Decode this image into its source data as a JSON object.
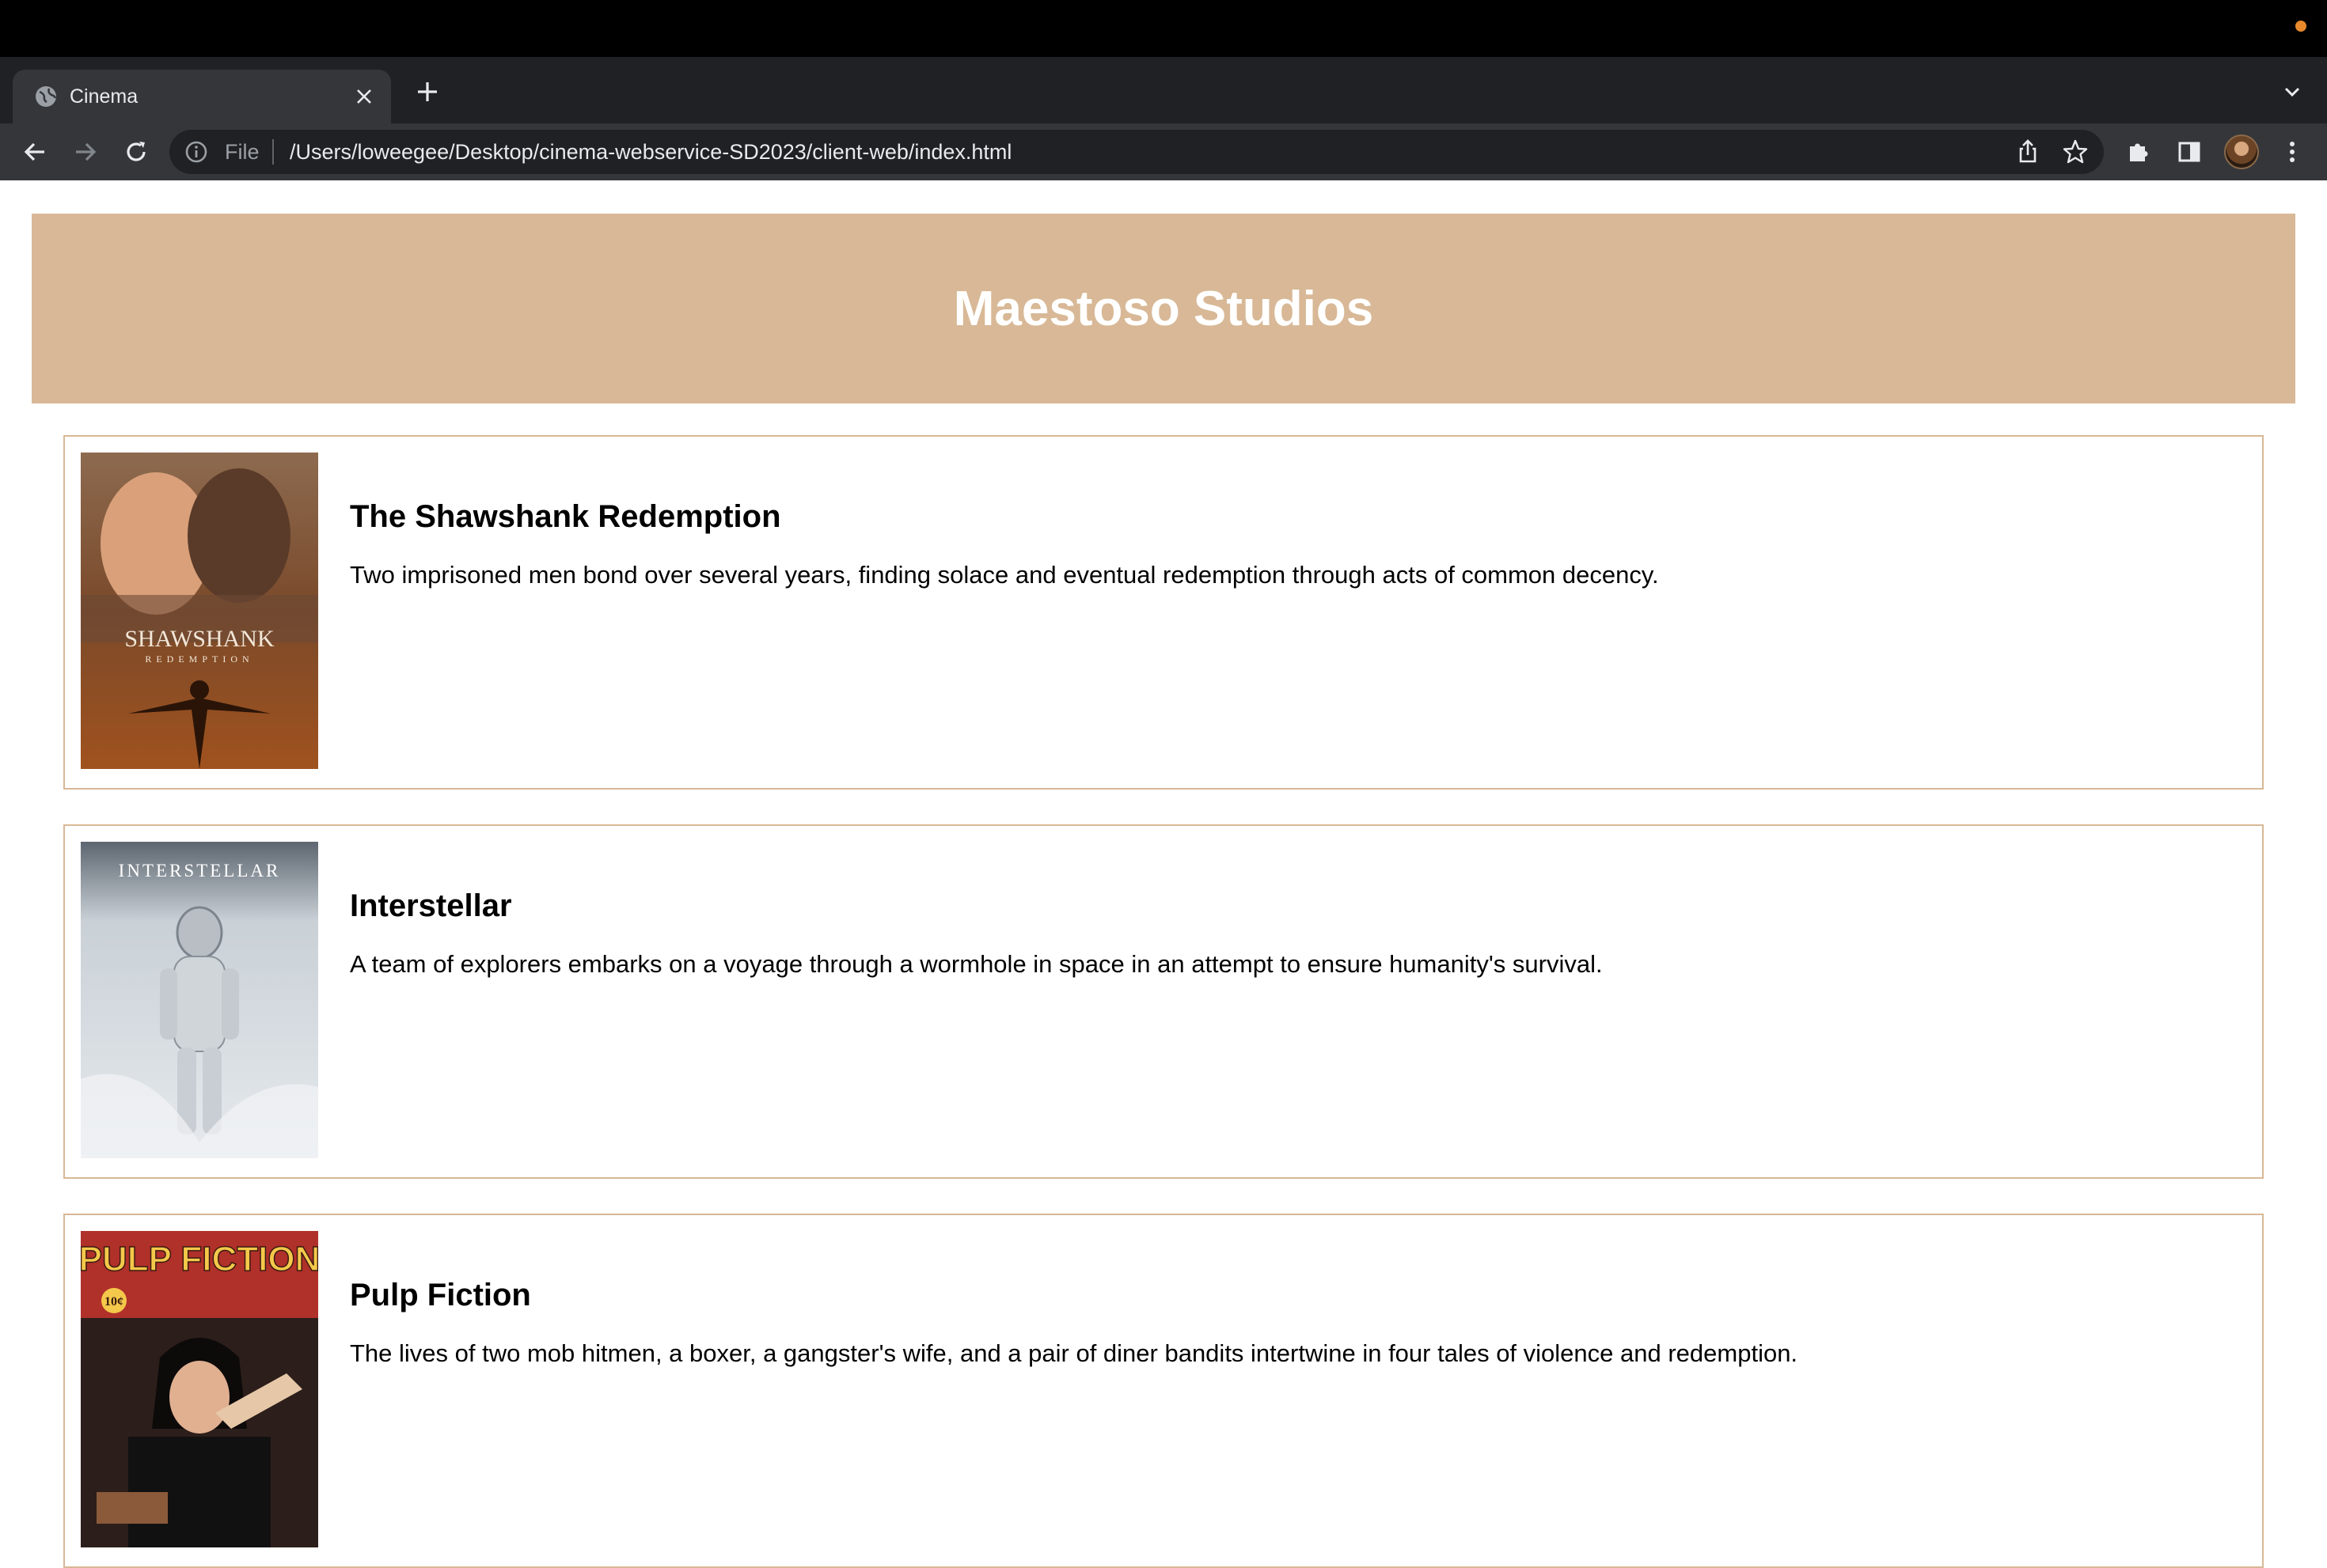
{
  "browser": {
    "tab": {
      "title": "Cinema"
    },
    "address_bar": {
      "scheme_label": "File",
      "url": "/Users/loweegee/Desktop/cinema-webservice-SD2023/client-web/index.html"
    }
  },
  "page": {
    "header": {
      "title": "Maestoso Studios"
    },
    "colors": {
      "accent": "#d8b896",
      "title_text": "#ffffff"
    },
    "movies": [
      {
        "title": "The Shawshank Redemption",
        "description": "Two imprisoned men bond over several years, finding solace and eventual redemption through acts of common decency.",
        "poster_text": "SHAWSHANK",
        "poster_subtext": "REDEMPTION"
      },
      {
        "title": "Interstellar",
        "description": "A team of explorers embarks on a voyage through a wormhole in space in an attempt to ensure humanity's survival.",
        "poster_text": "INTERSTELLAR"
      },
      {
        "title": "Pulp Fiction",
        "description": "The lives of two mob hitmen, a boxer, a gangster's wife, and a pair of diner bandits intertwine in four tales of violence and redemption.",
        "poster_text": "PULP FICTION",
        "poster_subtext": "10¢"
      }
    ]
  }
}
